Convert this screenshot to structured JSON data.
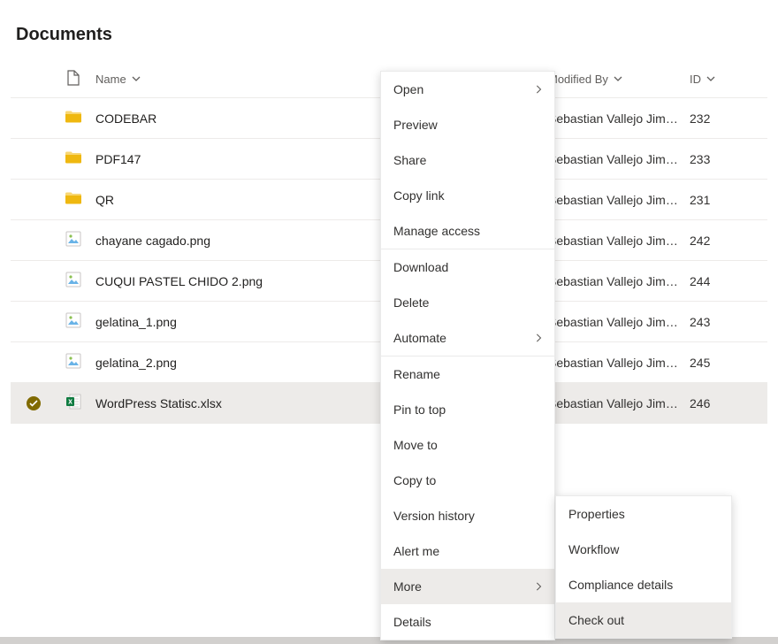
{
  "page": {
    "title": "Documents"
  },
  "columns": {
    "name": "Name",
    "modified_by": "Modified By",
    "id": "ID"
  },
  "rows": [
    {
      "type": "folder",
      "name": "CODEBAR",
      "modified_by": "Sebastian Vallejo Jime...",
      "id": "232",
      "selected": false
    },
    {
      "type": "folder",
      "name": "PDF147",
      "modified_by": "Sebastian Vallejo Jime...",
      "id": "233",
      "selected": false
    },
    {
      "type": "folder",
      "name": "QR",
      "modified_by": "Sebastian Vallejo Jime...",
      "id": "231",
      "selected": false
    },
    {
      "type": "image",
      "name": "chayane cagado.png",
      "modified_by": "Sebastian Vallejo Jime...",
      "id": "242",
      "selected": false
    },
    {
      "type": "image",
      "name": "CUQUI PASTEL CHIDO 2.png",
      "modified_by": "Sebastian Vallejo Jime...",
      "id": "244",
      "selected": false
    },
    {
      "type": "image",
      "name": "gelatina_1.png",
      "modified_by": "Sebastian Vallejo Jime...",
      "id": "243",
      "selected": false
    },
    {
      "type": "image",
      "name": "gelatina_2.png",
      "modified_by": "Sebastian Vallejo Jime...",
      "id": "245",
      "selected": false
    },
    {
      "type": "excel",
      "name": "WordPress Statisc.xlsx",
      "modified_by": "Sebastian Vallejo Jime...",
      "id": "246",
      "selected": true
    }
  ],
  "context_menu": {
    "groups": [
      [
        {
          "label": "Open",
          "submenu": true
        },
        {
          "label": "Preview"
        },
        {
          "label": "Share"
        },
        {
          "label": "Copy link"
        },
        {
          "label": "Manage access"
        }
      ],
      [
        {
          "label": "Download"
        },
        {
          "label": "Delete"
        },
        {
          "label": "Automate",
          "submenu": true
        }
      ],
      [
        {
          "label": "Rename"
        },
        {
          "label": "Pin to top"
        },
        {
          "label": "Move to"
        },
        {
          "label": "Copy to"
        },
        {
          "label": "Version history"
        },
        {
          "label": "Alert me"
        },
        {
          "label": "More",
          "submenu": true,
          "hover": true
        },
        {
          "label": "Details"
        }
      ]
    ]
  },
  "submenu": {
    "items": [
      {
        "label": "Properties"
      },
      {
        "label": "Workflow"
      },
      {
        "label": "Compliance details"
      },
      {
        "label": "Check out",
        "hover": true
      }
    ]
  }
}
